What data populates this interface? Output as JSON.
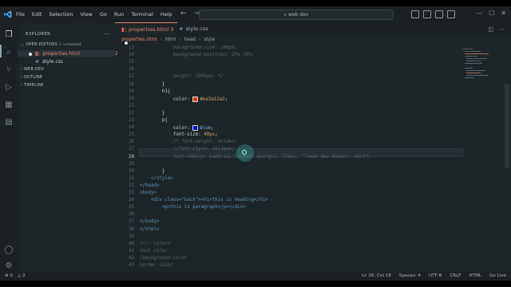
{
  "menu": [
    "File",
    "Edit",
    "Selection",
    "View",
    "Go",
    "Run",
    "Terminal",
    "Help"
  ],
  "search": {
    "text": "web dev"
  },
  "sidebar": {
    "title": "EXPLORER",
    "open_editors": {
      "label": "OPEN EDITORS",
      "count": "1 unsaved"
    },
    "files": [
      {
        "name": "properties.html",
        "problems": "2"
      },
      {
        "name": "style.css"
      }
    ],
    "sections": [
      "WEB DEV",
      "OUTLINE",
      "TIMELINE"
    ]
  },
  "tabs": [
    {
      "name": "properties.html",
      "count": "3"
    },
    {
      "name": "style.css"
    }
  ],
  "breadcrumb": [
    "properties.html",
    "html",
    "head",
    "style"
  ],
  "code": {
    "lines": [
      {
        "n": "13",
        "t": "            background-size: 200px;"
      },
      {
        "n": "14",
        "t": "            background-position: 25% 75%;"
      },
      {
        "n": "15",
        "t": ""
      },
      {
        "n": "16",
        "t": ""
      },
      {
        "n": "17",
        "t": "            height: 1000px; */"
      },
      {
        "n": "18",
        "t": "        }"
      },
      {
        "n": "19",
        "t": "        h1{"
      },
      {
        "n": "20",
        "t": "            color: #ea3a12a2;"
      },
      {
        "n": "21",
        "t": ""
      },
      {
        "n": "22",
        "t": "        }"
      },
      {
        "n": "23",
        "t": "        p{"
      },
      {
        "n": "24",
        "t": "            color: blue;"
      },
      {
        "n": "25",
        "t": "            font-size: 40px;"
      },
      {
        "n": "26",
        "t": "            /* font-weight: bolder;"
      },
      {
        "n": "27",
        "t": "            //font-style: oblique;"
      },
      {
        "n": "28",
        "t": "            font-family: Cambria, Cochin, Georgia, Times, 'Times New Roman', serif;"
      },
      {
        "n": "29",
        "t": ""
      },
      {
        "n": "30",
        "t": "        }"
      },
      {
        "n": "31",
        "t": "    </style>"
      },
      {
        "n": "32",
        "t": "</head>"
      },
      {
        "n": "33",
        "t": "<body>"
      },
      {
        "n": "34",
        "t": "    <div class=\"back\"><h1>this is heading</h1>"
      },
      {
        "n": "35",
        "t": "        <p>this is paragraph</p></div>"
      },
      {
        "n": "36",
        "t": ""
      },
      {
        "n": "37",
        "t": "</body>"
      },
      {
        "n": "38",
        "t": "</html>"
      },
      {
        "n": "39",
        "t": ""
      },
      {
        "n": "40",
        "t": "<!-- colors"
      },
      {
        "n": "41",
        "t": "text color"
      },
      {
        "n": "42",
        "t": "/background-color"
      },
      {
        "n": "43",
        "t": "border color"
      }
    ],
    "current_line": "28"
  },
  "status": {
    "left": [
      "⊗ 0",
      "△ 2"
    ],
    "right": [
      "Ln 28, Col 18",
      "Spaces: 4",
      "UTF-8",
      "CRLF",
      "HTML",
      "Go Live"
    ]
  },
  "colors": {
    "swatch_red": "#ea3a12",
    "swatch_blue": "#0000ff",
    "accent": "#e0886f"
  }
}
